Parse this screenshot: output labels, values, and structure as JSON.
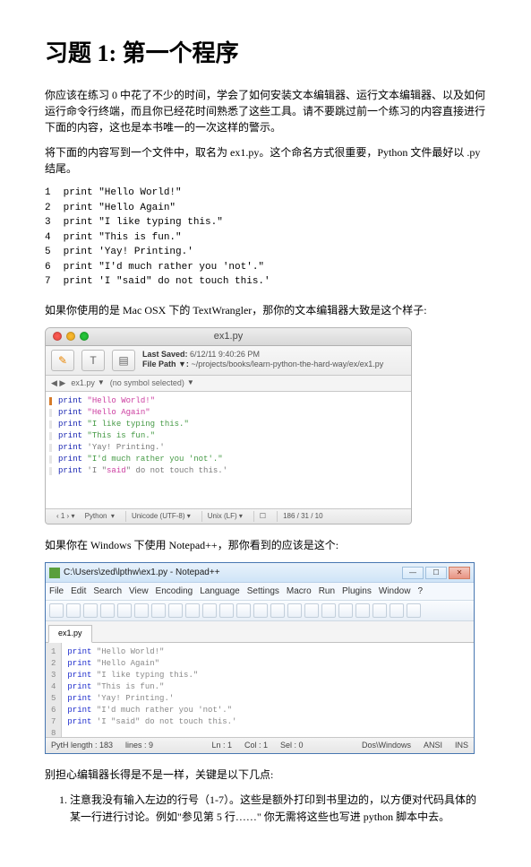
{
  "heading": "习题 1: 第一个程序",
  "para1": "你应该在练习 0 中花了不少的时间，学会了如何安装文本编辑器、运行文本编辑器、以及如何运行命令行终端，而且你已经花时间熟悉了这些工具。请不要跳过前一个练习的内容直接进行下面的内容，这也是本书唯一的一次这样的警示。",
  "para2": "将下面的内容写到一个文件中，取名为 ex1.py。这个命名方式很重要，Python 文件最好以 .py 结尾。",
  "code": {
    "lines": [
      "print \"Hello World!\"",
      "print \"Hello Again\"",
      "print \"I like typing this.\"",
      "print \"This is fun.\"",
      "print 'Yay! Printing.'",
      "print \"I'd much rather you 'not'.\"",
      "print 'I \"said\" do not touch this.'"
    ]
  },
  "para3": "如果你使用的是 Mac OSX 下的 TextWrangler，那你的文本编辑器大致是这个样子:",
  "mac": {
    "title": "ex1.py",
    "saved_label": "Last Saved:",
    "saved_value": "6/12/11 9:40:26 PM",
    "path_label": "File Path ▼:",
    "path_value": "~/projects/books/learn-python-the-hard-way/ex/ex1.py",
    "file_dropdown": "ex1.py",
    "symbol_dropdown": "(no symbol selected)",
    "status": {
      "lang": "Python",
      "encoding": "Unicode (UTF-8)",
      "lineend": "Unix (LF)",
      "pos": "186 / 31 / 10"
    }
  },
  "para4": "如果你在 Windows 下使用 Notepad++，那你看到的应该是这个:",
  "win": {
    "title": "C:\\Users\\zed\\lpthw\\ex1.py - Notepad++",
    "menu": [
      "File",
      "Edit",
      "Search",
      "View",
      "Encoding",
      "Language",
      "Settings",
      "Macro",
      "Run",
      "Plugins",
      "Window",
      "?"
    ],
    "tab": "ex1.py",
    "status": {
      "left": [
        "PytH length : 183",
        "lines : 9"
      ],
      "mid": [
        "Ln : 1",
        "Col : 1",
        "Sel : 0"
      ],
      "right": [
        "Dos\\Windows",
        "ANSI",
        "INS"
      ]
    }
  },
  "para5": "别担心编辑器长得是不是一样，关键是以下几点:",
  "list1": "注意我没有输入左边的行号（1-7）。这些是额外打印到书里边的，以方便对代码具体的某一行进行讨论。例如\"参见第 5 行……\" 你无需将这些也写进 python 脚本中去。"
}
